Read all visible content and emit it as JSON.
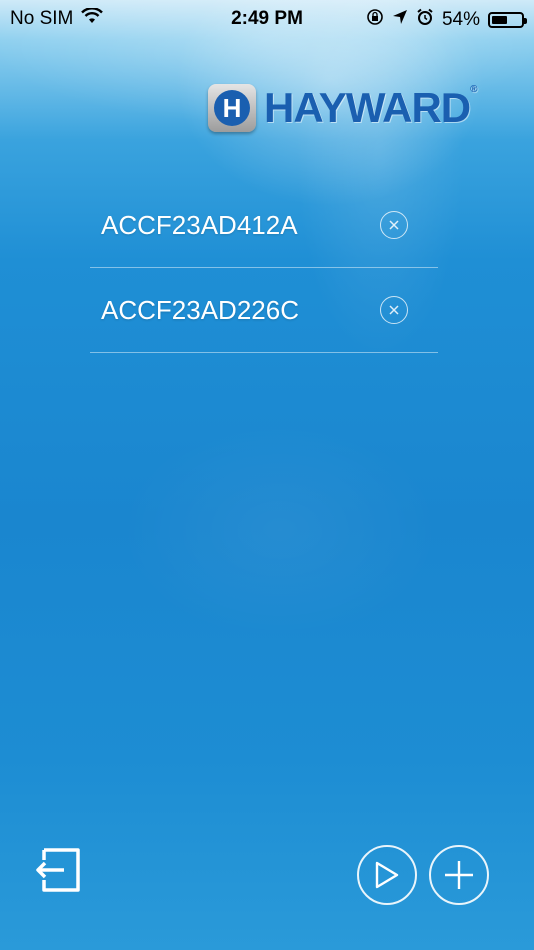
{
  "status_bar": {
    "carrier": "No SIM",
    "time": "2:49 PM",
    "battery_percent": "54%",
    "battery_level": 0.54,
    "icons": [
      "wifi-icon",
      "orientation-lock-icon",
      "location-icon",
      "alarm-icon",
      "battery-icon"
    ]
  },
  "logo": {
    "mark_letter": "H",
    "text": "HAYWARD",
    "registered": "®"
  },
  "devices": [
    {
      "name": "ACCF23AD412A",
      "remove_icon": "close-circle-icon"
    },
    {
      "name": "ACCF23AD226C",
      "remove_icon": "close-circle-icon"
    }
  ],
  "actions": {
    "exit_icon": "exit-icon",
    "play_icon": "play-icon",
    "add_icon": "plus-icon"
  },
  "colors": {
    "brand_blue": "#1a5fb0",
    "background_top": "#3aa3de",
    "background_bottom": "#1a86cf",
    "foreground": "#ffffff"
  }
}
